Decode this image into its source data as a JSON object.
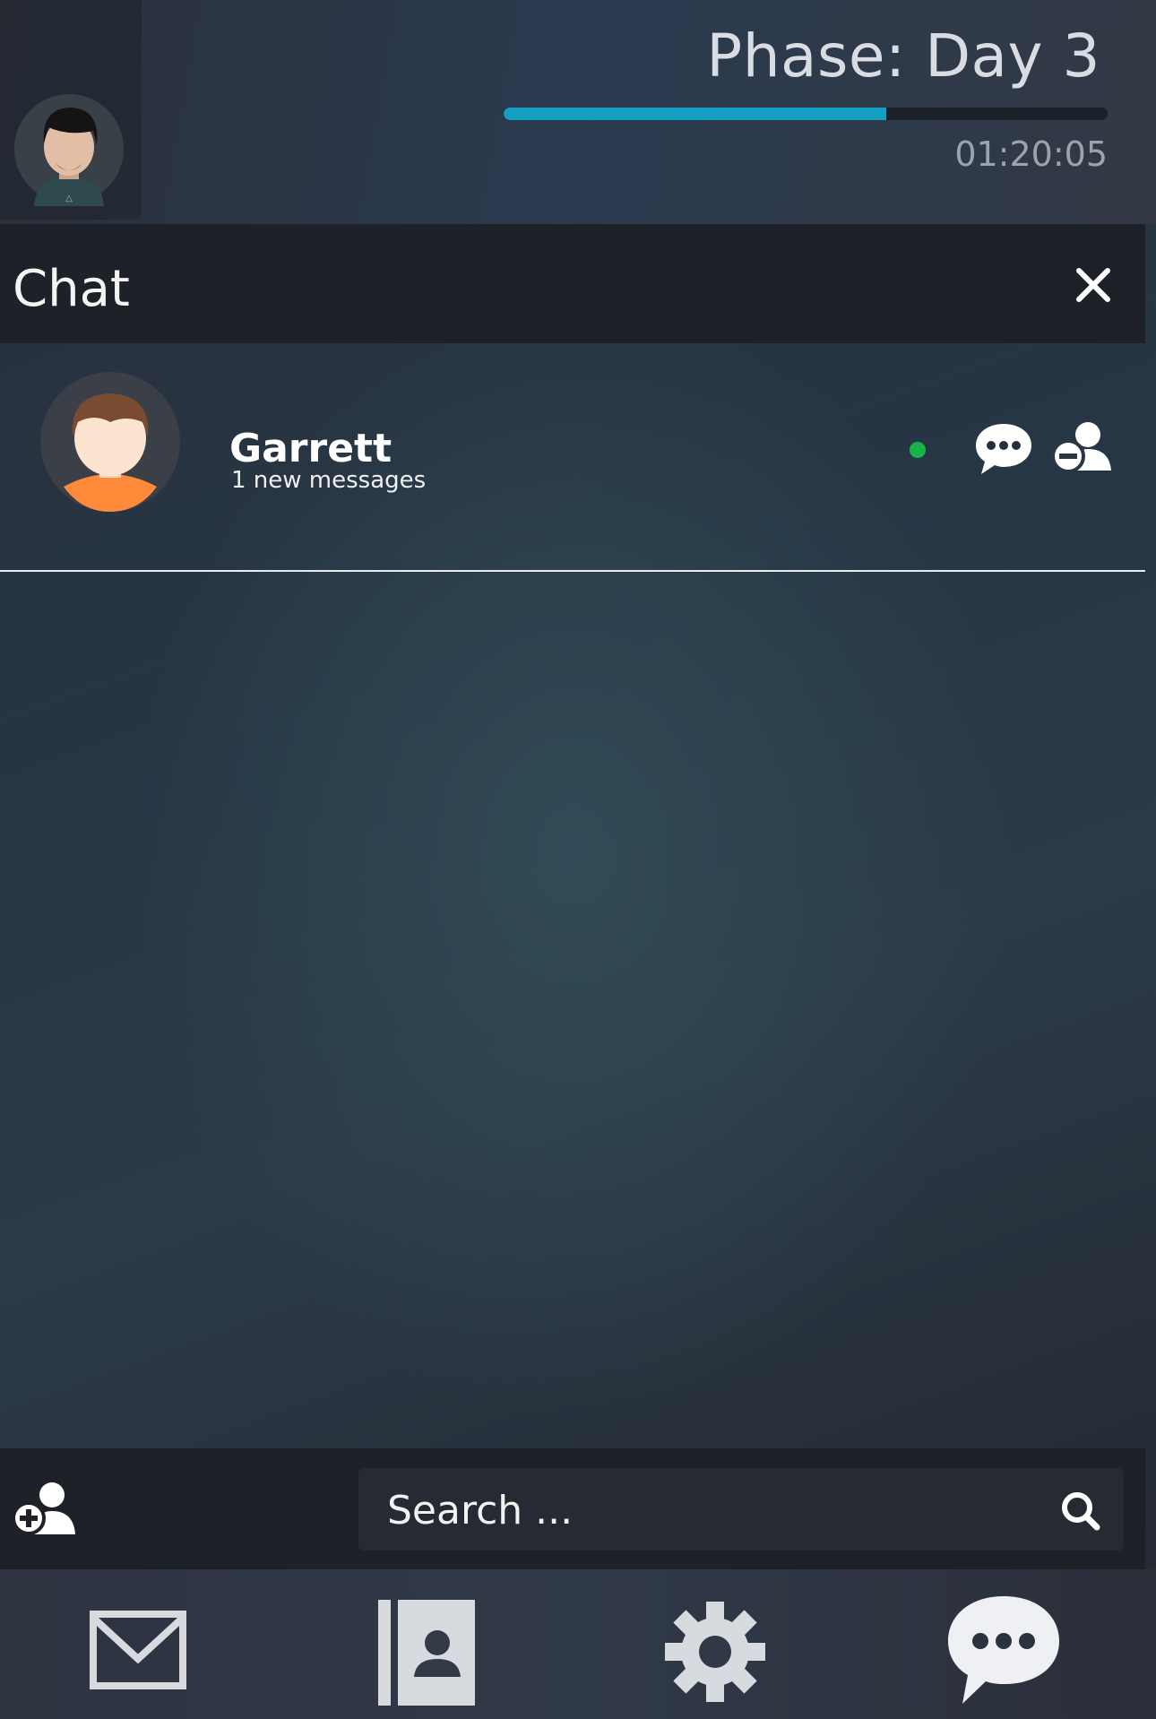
{
  "header": {
    "phase_title": "Phase: Day 3",
    "progress_fraction": 0.634,
    "timer": "01:20:05",
    "progress_color": "#149ec2"
  },
  "chat_panel": {
    "title": "Chat",
    "close_icon": "close-icon"
  },
  "contacts": [
    {
      "name": "Garrett",
      "status_text": "1 new messages",
      "online": true,
      "online_color": "#19b34a",
      "actions": [
        "chat-bubble-icon",
        "remove-contact-icon"
      ]
    }
  ],
  "bottom_bar": {
    "add_contact_icon": "add-contact-icon",
    "search_placeholder": "Search ..."
  },
  "nav": {
    "items": [
      "mail-icon",
      "contacts-book-icon",
      "settings-gear-icon",
      "chat-icon"
    ]
  }
}
